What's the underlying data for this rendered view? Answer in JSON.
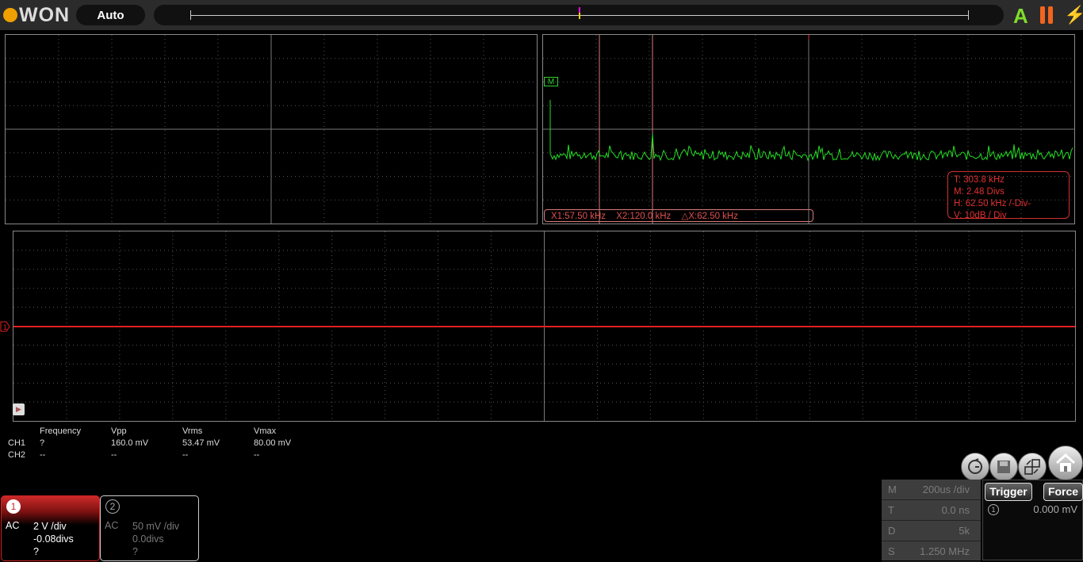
{
  "header": {
    "logo_text": "WON",
    "mode": "Auto"
  },
  "fft": {
    "marker_label": "M",
    "cursors": {
      "x1": "X1:57.50 kHz",
      "x2": "X2:120.0 kHz",
      "dx": "△X:62.50 kHz"
    },
    "info": [
      "T: 303.8 kHz",
      "M: 2.48 Divs",
      "H: 62.50 kHz /-Div-",
      "V: 10dB / Div"
    ]
  },
  "channel_marker": "1",
  "measurements": {
    "headers": [
      "Frequency",
      "Vpp",
      "Vrms",
      "Vmax"
    ],
    "rows": [
      {
        "ch": "CH1",
        "values": [
          "?",
          "160.0 mV",
          "53.47 mV",
          "80.00 mV"
        ]
      },
      {
        "ch": "CH2",
        "values": [
          "--",
          "--",
          "--",
          "--"
        ]
      }
    ]
  },
  "channels": [
    {
      "num": "1",
      "coupling": "AC",
      "scale": "2 V /div",
      "offset": "-0.08divs",
      "extra": "?"
    },
    {
      "num": "2",
      "coupling": "AC",
      "scale": "50 mV /div",
      "offset": "0.0divs",
      "extra": "?"
    }
  ],
  "timebase": [
    {
      "key": "M",
      "value": "200us /div"
    },
    {
      "key": "T",
      "value": "0.0 ns"
    },
    {
      "key": "D",
      "value": "5k"
    },
    {
      "key": "S",
      "value": "1.250 MHz"
    }
  ],
  "trigger": {
    "trigger_label": "Trigger",
    "force_label": "Force",
    "source": "1",
    "level": "0.000 mV"
  },
  "colors": {
    "ch1": "#e02020",
    "fft": "#22e022",
    "grid": "#555555",
    "accent": "#f0a000"
  }
}
